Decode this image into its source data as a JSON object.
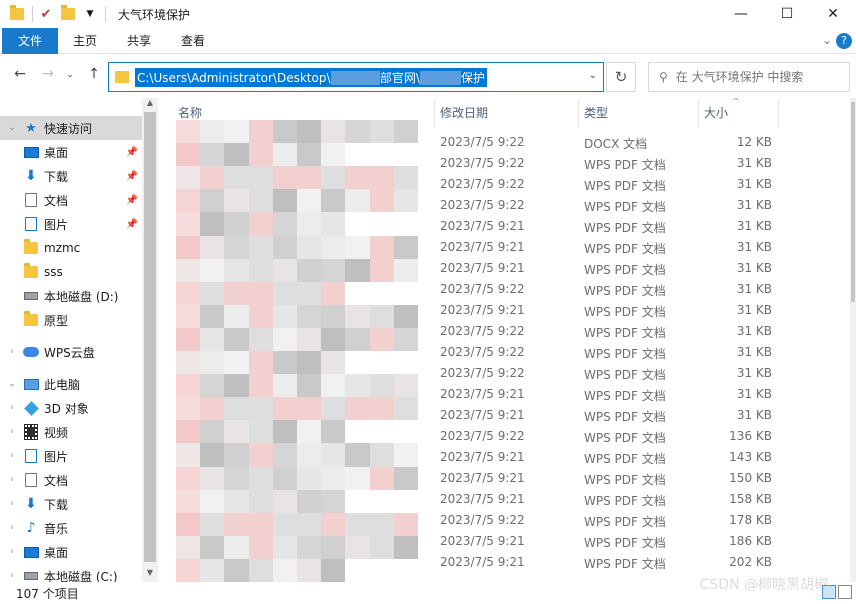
{
  "window": {
    "title": "大气环境保护",
    "controls": [
      "—",
      "☐",
      "✕"
    ]
  },
  "ribbon": {
    "tabs": [
      "文件",
      "主页",
      "共享",
      "查看"
    ]
  },
  "address": {
    "path_start": "C:\\Users\\Administrator\\Desktop\\",
    "path_mid": "部官网\\",
    "path_end": "保护",
    "search_placeholder": "在 大气环境保护 中搜索"
  },
  "sidebar": {
    "items": [
      {
        "label": "快速访问",
        "icon": "star-icon",
        "pinned": false
      },
      {
        "label": "桌面",
        "icon": "desktop-icon",
        "pinned": true
      },
      {
        "label": "下载",
        "icon": "download-icon",
        "pinned": true
      },
      {
        "label": "文档",
        "icon": "document-icon",
        "pinned": true
      },
      {
        "label": "图片",
        "icon": "picture-icon",
        "pinned": true
      },
      {
        "label": "mzmc",
        "icon": "folder-icon",
        "pinned": false
      },
      {
        "label": "sss",
        "icon": "folder-icon",
        "pinned": false
      },
      {
        "label": "本地磁盘 (D:)",
        "icon": "drive-icon",
        "pinned": false
      },
      {
        "label": "原型",
        "icon": "folder-icon",
        "pinned": false
      },
      {
        "label": "WPS云盘",
        "icon": "cloud-icon",
        "pinned": false
      },
      {
        "label": "此电脑",
        "icon": "computer-icon",
        "pinned": false
      },
      {
        "label": "3D 对象",
        "icon": "cube-icon",
        "pinned": false
      },
      {
        "label": "视频",
        "icon": "video-icon",
        "pinned": false
      },
      {
        "label": "图片",
        "icon": "picture-icon",
        "pinned": false
      },
      {
        "label": "文档",
        "icon": "document-icon",
        "pinned": false
      },
      {
        "label": "下载",
        "icon": "download-icon",
        "pinned": false
      },
      {
        "label": "音乐",
        "icon": "music-icon",
        "pinned": false
      },
      {
        "label": "桌面",
        "icon": "desktop-icon",
        "pinned": false
      },
      {
        "label": "本地磁盘 (C:)",
        "icon": "drive-icon",
        "pinned": false
      }
    ]
  },
  "columns": {
    "name": "名称",
    "date": "修改日期",
    "type": "类型",
    "size": "大小"
  },
  "files": [
    {
      "date": "2023/7/5 9:22",
      "type": "DOCX 文档",
      "size": "12 KB"
    },
    {
      "date": "2023/7/5 9:22",
      "type": "WPS PDF 文档",
      "size": "31 KB"
    },
    {
      "date": "2023/7/5 9:22",
      "type": "WPS PDF 文档",
      "size": "31 KB"
    },
    {
      "date": "2023/7/5 9:22",
      "type": "WPS PDF 文档",
      "size": "31 KB"
    },
    {
      "date": "2023/7/5 9:21",
      "type": "WPS PDF 文档",
      "size": "31 KB"
    },
    {
      "date": "2023/7/5 9:21",
      "type": "WPS PDF 文档",
      "size": "31 KB"
    },
    {
      "date": "2023/7/5 9:21",
      "type": "WPS PDF 文档",
      "size": "31 KB"
    },
    {
      "date": "2023/7/5 9:22",
      "type": "WPS PDF 文档",
      "size": "31 KB"
    },
    {
      "date": "2023/7/5 9:21",
      "type": "WPS PDF 文档",
      "size": "31 KB"
    },
    {
      "date": "2023/7/5 9:22",
      "type": "WPS PDF 文档",
      "size": "31 KB"
    },
    {
      "date": "2023/7/5 9:22",
      "type": "WPS PDF 文档",
      "size": "31 KB"
    },
    {
      "date": "2023/7/5 9:22",
      "type": "WPS PDF 文档",
      "size": "31 KB"
    },
    {
      "date": "2023/7/5 9:21",
      "type": "WPS PDF 文档",
      "size": "31 KB"
    },
    {
      "date": "2023/7/5 9:21",
      "type": "WPS PDF 文档",
      "size": "31 KB"
    },
    {
      "date": "2023/7/5 9:22",
      "type": "WPS PDF 文档",
      "size": "136 KB"
    },
    {
      "date": "2023/7/5 9:21",
      "type": "WPS PDF 文档",
      "size": "143 KB"
    },
    {
      "date": "2023/7/5 9:21",
      "type": "WPS PDF 文档",
      "size": "150 KB"
    },
    {
      "date": "2023/7/5 9:21",
      "type": "WPS PDF 文档",
      "size": "158 KB"
    },
    {
      "date": "2023/7/5 9:22",
      "type": "WPS PDF 文档",
      "size": "178 KB"
    },
    {
      "date": "2023/7/5 9:21",
      "type": "WPS PDF 文档",
      "size": "186 KB"
    },
    {
      "date": "2023/7/5 9:21",
      "type": "WPS PDF 文档",
      "size": "202 KB"
    }
  ],
  "status": {
    "item_count": "107 个项目"
  },
  "watermark": "CSDN @柳晓黑胡椒"
}
